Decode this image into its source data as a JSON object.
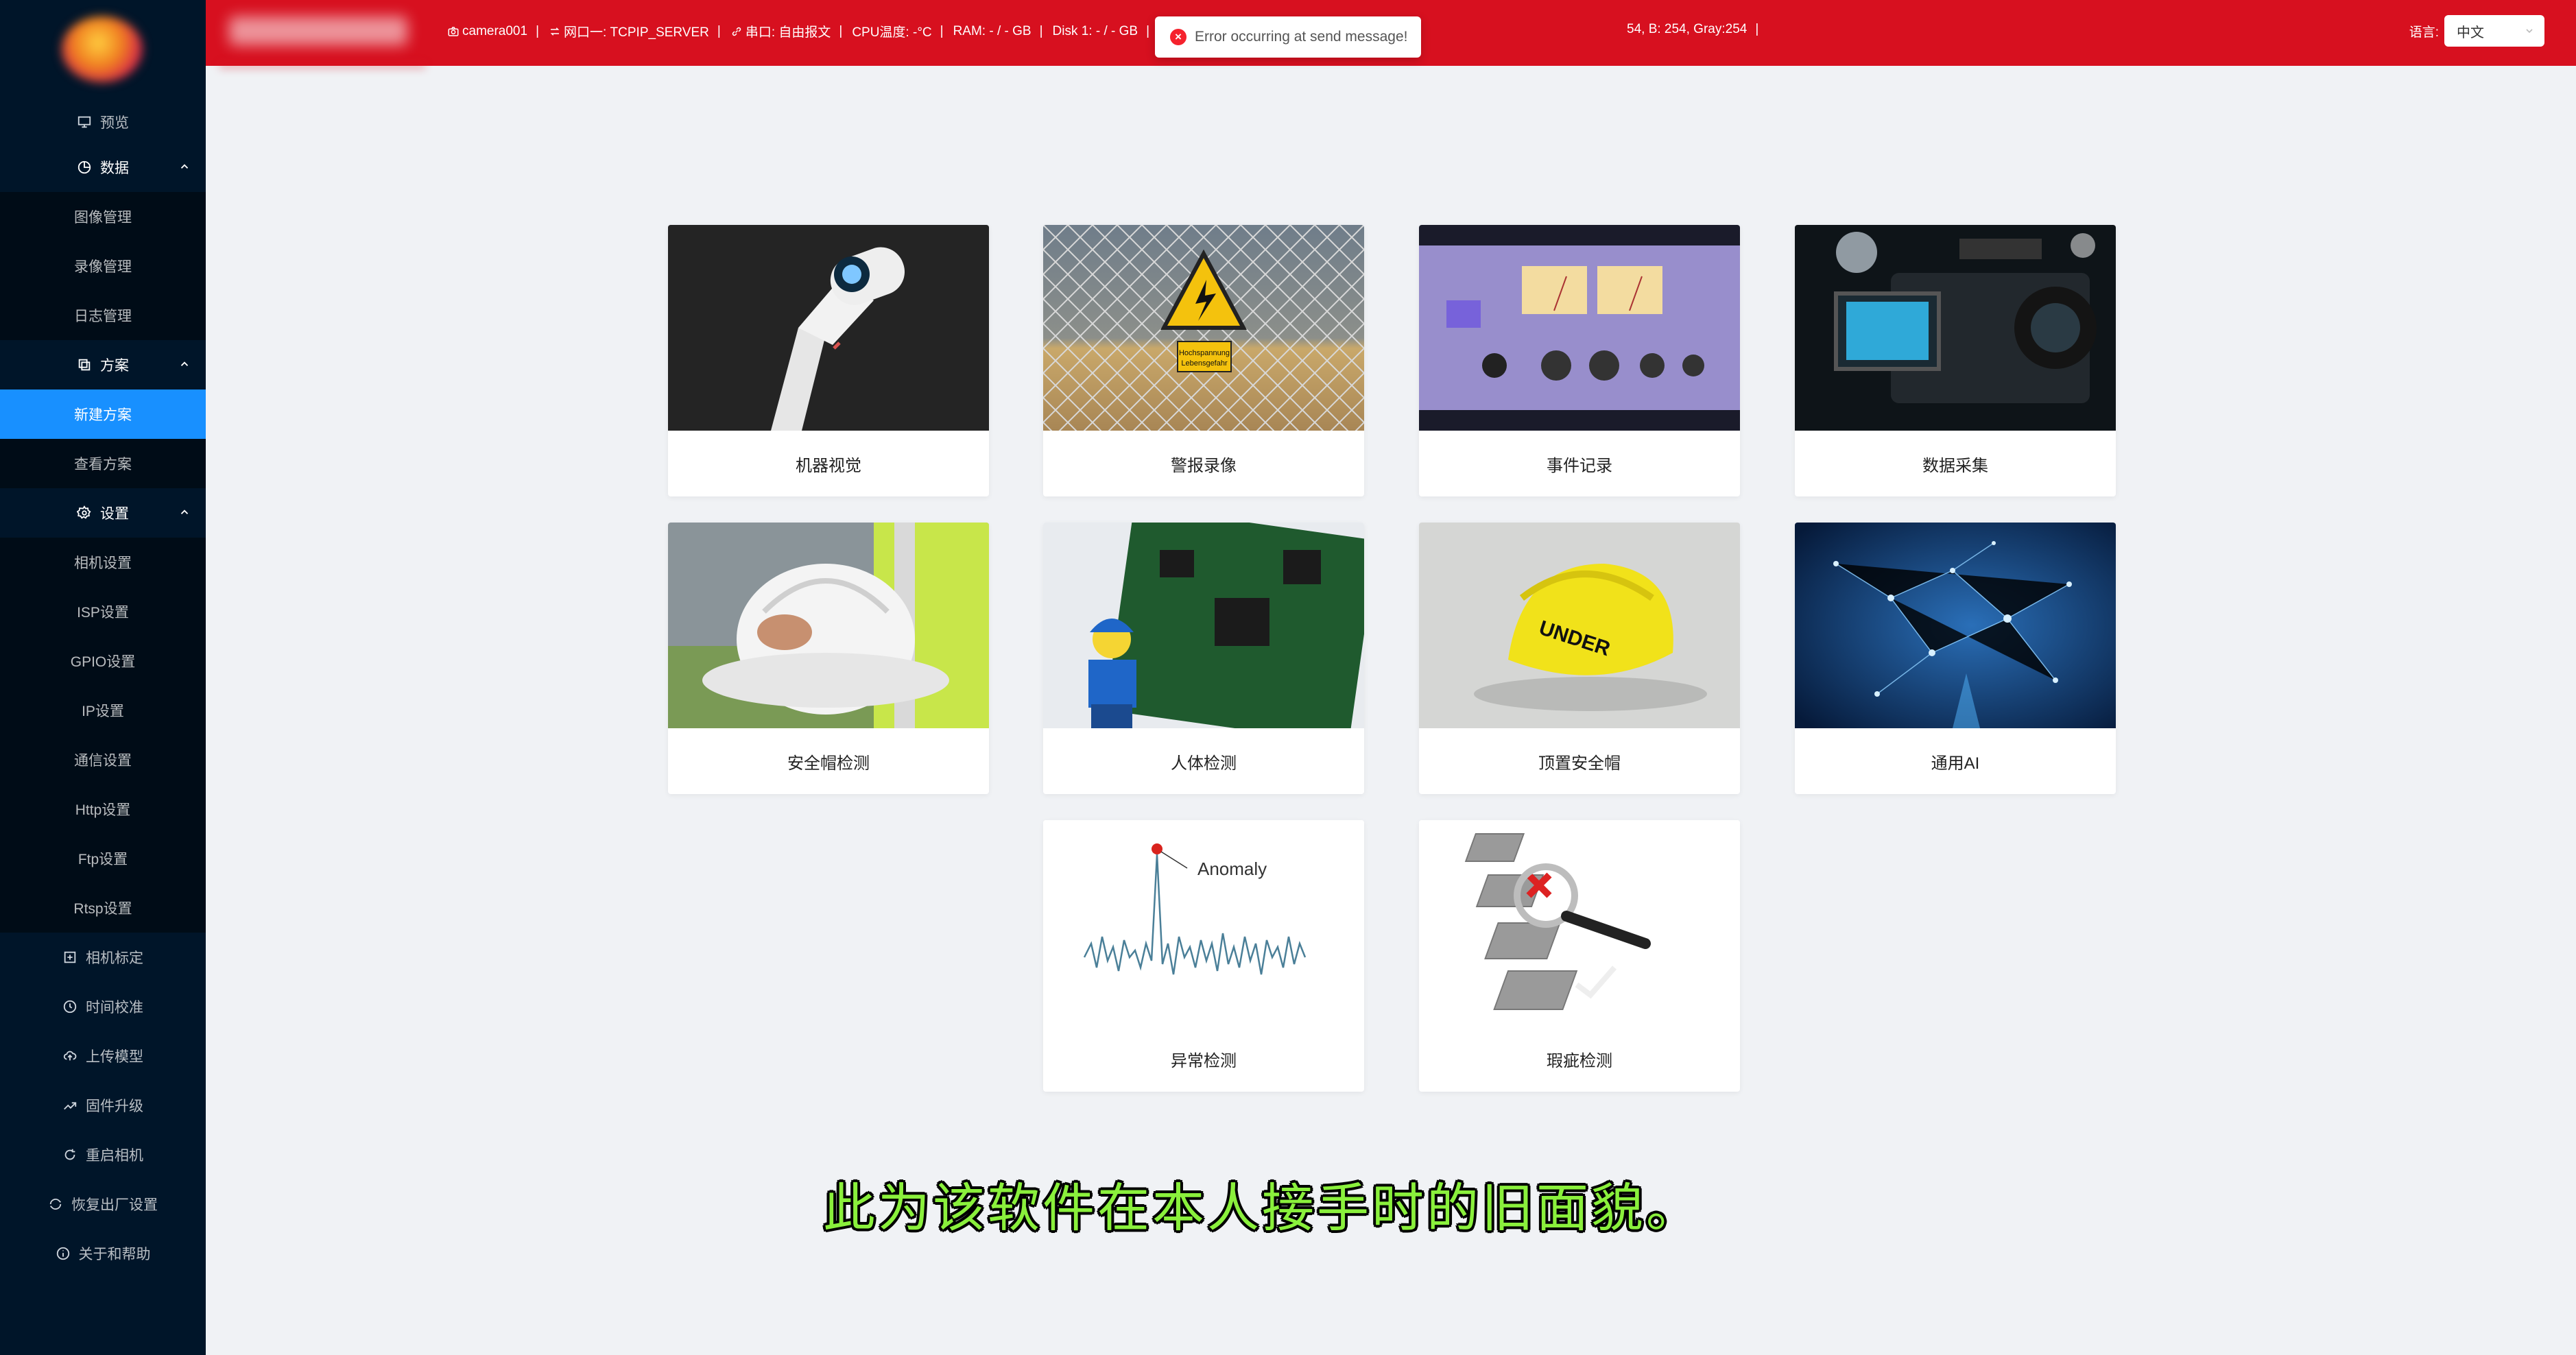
{
  "colors": {
    "header": "#d7101f",
    "sidebar": "#001529",
    "active": "#1890ff",
    "subtitle": "#8af03c"
  },
  "sidebar": {
    "preview": "预览",
    "data_group": "数据",
    "data_items": [
      "图像管理",
      "录像管理",
      "日志管理"
    ],
    "plan_group": "方案",
    "plan_items": [
      "新建方案",
      "查看方案"
    ],
    "settings_group": "设置",
    "settings_items": [
      "相机设置",
      "ISP设置",
      "GPIO设置",
      "IP设置",
      "通信设置",
      "Http设置",
      "Ftp设置",
      "Rtsp设置"
    ],
    "bottom_items": [
      "相机标定",
      "时间校准",
      "上传模型",
      "固件升级",
      "重启相机",
      "恢复出厂设置",
      "关于和帮助"
    ]
  },
  "header": {
    "camera": "camera001",
    "port": "网口一: TCPIP_SERVER",
    "serial": "串口: 自由报文",
    "cpu": "CPU温度: -°C",
    "ram": "RAM: - / - GB",
    "disk": "Disk 1: - / - GB",
    "color_readout": "54, B: 254, Gray:254",
    "lang_label": "语言:",
    "lang_value": "中文"
  },
  "toast": {
    "message": "Error occurring at send message!"
  },
  "cards": [
    "机器视觉",
    "警报录像",
    "事件记录",
    "数据采集",
    "安全帽检测",
    "人体检测",
    "顶置安全帽",
    "通用AI",
    "异常检测",
    "瑕疵检测"
  ],
  "card_texts": {
    "anomaly": "Anomaly",
    "sign_line1": "Hochspannung",
    "sign_line2": "Lebensgefahr",
    "helmet_text": "UNDER"
  },
  "subtitle": "此为该软件在本人接手时的旧面貌。"
}
